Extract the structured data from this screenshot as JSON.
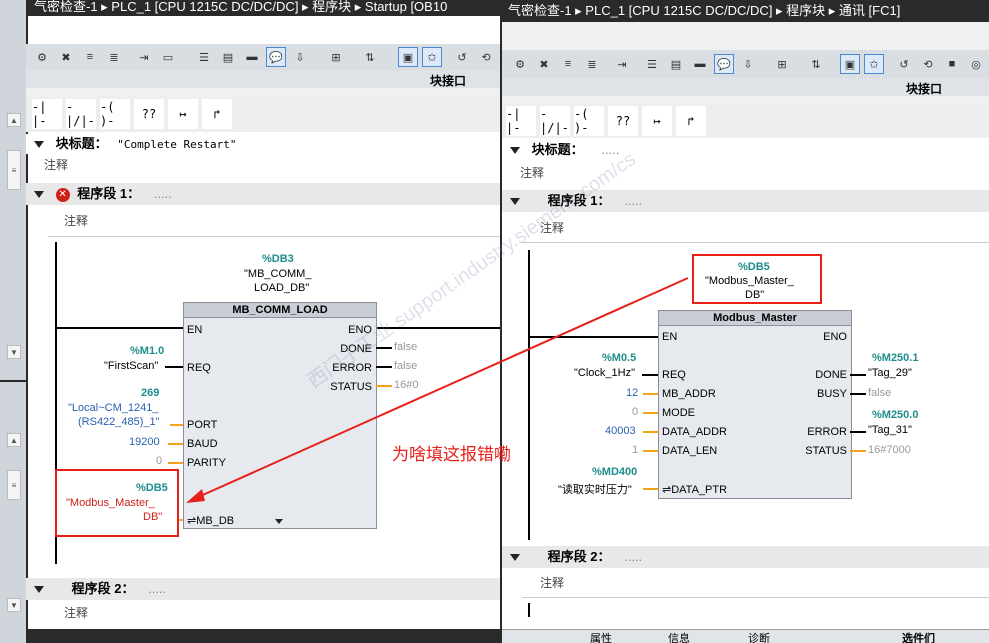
{
  "left": {
    "title": "气密检查-1 ▸ PLC_1 [CPU 1215C DC/DC/DC] ▸ 程序块 ▸ Startup [OB10",
    "interface_label": "块接口",
    "block_title_label": "块标题：",
    "block_title_value": "\"Complete Restart\"",
    "comment": "注释",
    "network1_label": "程序段 1：",
    "network1_dots": ".....",
    "network2_label": "程序段 2：",
    "network2_dots": ".....",
    "instance_addr": "%DB3",
    "instance_name_1": "\"MB_COMM_",
    "instance_name_2": "LOAD_DB\"",
    "block_name": "MB_COMM_LOAD",
    "pins_in": [
      "EN",
      "REQ",
      "PORT",
      "BAUD",
      "PARITY",
      "MB_DB"
    ],
    "pins_out": [
      "ENO",
      "DONE",
      "ERROR",
      "STATUS"
    ],
    "req_addr": "%M1.0",
    "req_tag": "\"FirstScan\"",
    "port_value": "269",
    "port_tag_1": "\"Local~CM_1241_",
    "port_tag_2": "(RS422_485)_1\"",
    "baud_value": "19200",
    "parity_value": "0",
    "mbdb_addr": "%DB5",
    "mbdb_tag_1": "\"Modbus_Master_",
    "mbdb_tag_2": "DB\"",
    "done_value": "false",
    "error_value": "false",
    "status_value": "16#0"
  },
  "right": {
    "title": "气密检查-1 ▸ PLC_1 [CPU 1215C DC/DC/DC] ▸ 程序块 ▸ 通讯 [FC1]",
    "interface_label": "块接口",
    "block_title_label": "块标题：",
    "block_title_value": ".....",
    "comment": "注释",
    "network1_label": "程序段 1：",
    "network1_dots": ".....",
    "network2_label": "程序段 2：",
    "network2_dots": ".....",
    "instance_addr": "%DB5",
    "instance_name_1": "\"Modbus_Master_",
    "instance_name_2": "DB\"",
    "block_name": "Modbus_Master",
    "pins_in": [
      "EN",
      "REQ",
      "MB_ADDR",
      "MODE",
      "DATA_ADDR",
      "DATA_LEN",
      "DATA_PTR"
    ],
    "pins_out": [
      "ENO",
      "DONE",
      "BUSY",
      "ERROR",
      "STATUS"
    ],
    "req_addr": "%M0.5",
    "req_tag": "\"Clock_1Hz\"",
    "mb_addr_value": "12",
    "mode_value": "0",
    "data_addr_value": "40003",
    "data_len_value": "1",
    "data_ptr_addr": "%MD400",
    "data_ptr_tag": "\"读取实时压力\"",
    "done_addr": "%M250.1",
    "done_tag": "\"Tag_29\"",
    "busy_value": "false",
    "error_addr": "%M250.0",
    "error_tag": "\"Tag_31\"",
    "status_value": "16#7000",
    "bottom_tabs": [
      "属性",
      "信息",
      "诊断",
      "选件们"
    ]
  },
  "annotation": {
    "text": "为啥填这报错嘞",
    "color": "#e8201a"
  },
  "watermark": "西门子工业 support.industry.siemens.com/cs",
  "ladder_buttons": [
    "-| |-",
    "-|/|-",
    "-( )-",
    "??",
    "↦",
    "↱"
  ]
}
